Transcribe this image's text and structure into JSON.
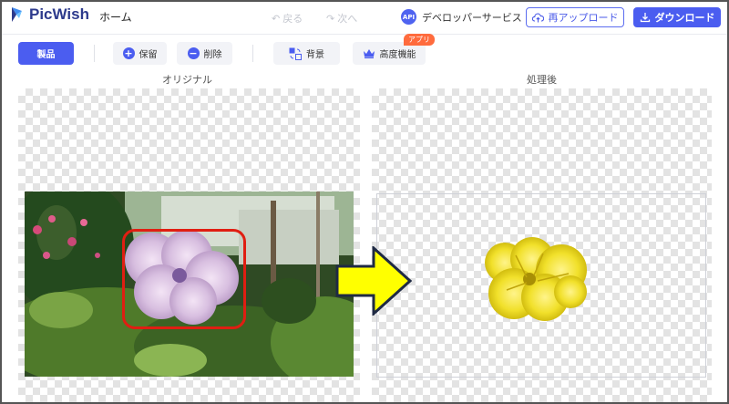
{
  "header": {
    "logo_text": "PicWish",
    "nav_home": "ホーム",
    "undo_label": "戻る",
    "redo_label": "次へ",
    "api_badge": "API",
    "api_label": "デベロッパーサービス",
    "reupload_label": "再アップロード",
    "download_label": "ダウンロード"
  },
  "toolbar": {
    "products_label": "製品",
    "save_label": "保留",
    "delete_label": "削除",
    "background_label": "背景",
    "advanced_label": "高度機能",
    "app_badge": "アプリ"
  },
  "panels": {
    "original_label": "オリジナル",
    "processed_label": "処理後"
  },
  "colors": {
    "brand": "#4b5df0",
    "highlight_box": "#e01e12",
    "arrow_fill": "#ffff00",
    "app_badge": "#ff6b3d"
  },
  "icons": [
    "picwish-logo-icon",
    "undo-icon",
    "redo-icon",
    "upload-cloud-icon",
    "download-icon",
    "plus-circle-icon",
    "minus-circle-icon",
    "background-icon",
    "crown-icon",
    "right-arrow-icon"
  ]
}
